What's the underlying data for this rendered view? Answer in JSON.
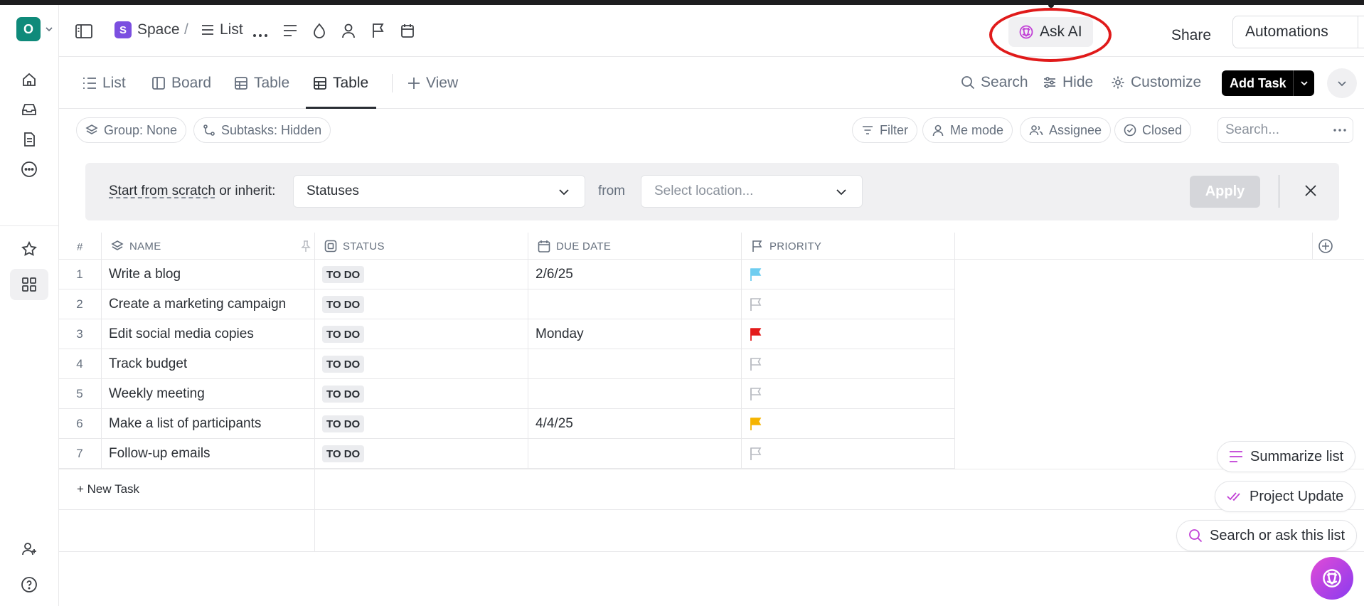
{
  "workspace": {
    "initial": "O"
  },
  "breadcrumb": {
    "space_initial": "S",
    "space_label": "Space",
    "separator": "/",
    "list_label": "List"
  },
  "topbar": {
    "ask_ai": "Ask AI",
    "share": "Share",
    "automations": "Automations"
  },
  "view_tabs": [
    {
      "label": "List",
      "icon": "list-icon"
    },
    {
      "label": "Board",
      "icon": "board-icon"
    },
    {
      "label": "Table",
      "icon": "table-icon"
    },
    {
      "label": "Table",
      "icon": "table-icon",
      "active": true
    }
  ],
  "add_view": "View",
  "view_actions": {
    "search": "Search",
    "hide": "Hide",
    "customize": "Customize",
    "add_task": "Add Task"
  },
  "filters": {
    "group": "Group: None",
    "subtasks": "Subtasks: Hidden",
    "filter": "Filter",
    "me_mode": "Me mode",
    "assignee": "Assignee",
    "closed": "Closed",
    "search_placeholder": "Search..."
  },
  "banner": {
    "start_link": "Start from scratch",
    "inherit_text": " or inherit:",
    "statuses_value": "Statuses",
    "from_label": "from",
    "location_placeholder": "Select location...",
    "apply": "Apply"
  },
  "table": {
    "headers": {
      "num": "#",
      "name": "NAME",
      "status": "STATUS",
      "due": "DUE DATE",
      "priority": "PRIORITY"
    },
    "rows": [
      {
        "num": "1",
        "name": "Write a blog",
        "status": "TO DO",
        "due": "2/6/25",
        "priority": "low",
        "flag_color": "#6fcdf0"
      },
      {
        "num": "2",
        "name": "Create a marketing campaign",
        "status": "TO DO",
        "due": "",
        "priority": "none",
        "flag_color": "#b9bcc2"
      },
      {
        "num": "3",
        "name": "Edit social media copies",
        "status": "TO DO",
        "due": "Monday",
        "priority": "urgent",
        "flag_color": "#e31b1b"
      },
      {
        "num": "4",
        "name": "Track budget",
        "status": "TO DO",
        "due": "",
        "priority": "none",
        "flag_color": "#b9bcc2"
      },
      {
        "num": "5",
        "name": "Weekly meeting",
        "status": "TO DO",
        "due": "",
        "priority": "none",
        "flag_color": "#b9bcc2"
      },
      {
        "num": "6",
        "name": "Make a list of participants",
        "status": "TO DO",
        "due": "4/4/25",
        "priority": "high",
        "flag_color": "#f5b400"
      },
      {
        "num": "7",
        "name": "Follow-up emails",
        "status": "TO DO",
        "due": "",
        "priority": "none",
        "flag_color": "#b9bcc2"
      }
    ],
    "new_task": "+ New Task"
  },
  "ai_suggestions": {
    "summarize": "Summarize list",
    "project_update": "Project Update",
    "search_ask": "Search or ask this list"
  },
  "colors": {
    "accent_ai": "#c13fd6",
    "workspace": "#0f8a7a",
    "space": "#7b4fe0",
    "highlight": "#e01a1a"
  }
}
